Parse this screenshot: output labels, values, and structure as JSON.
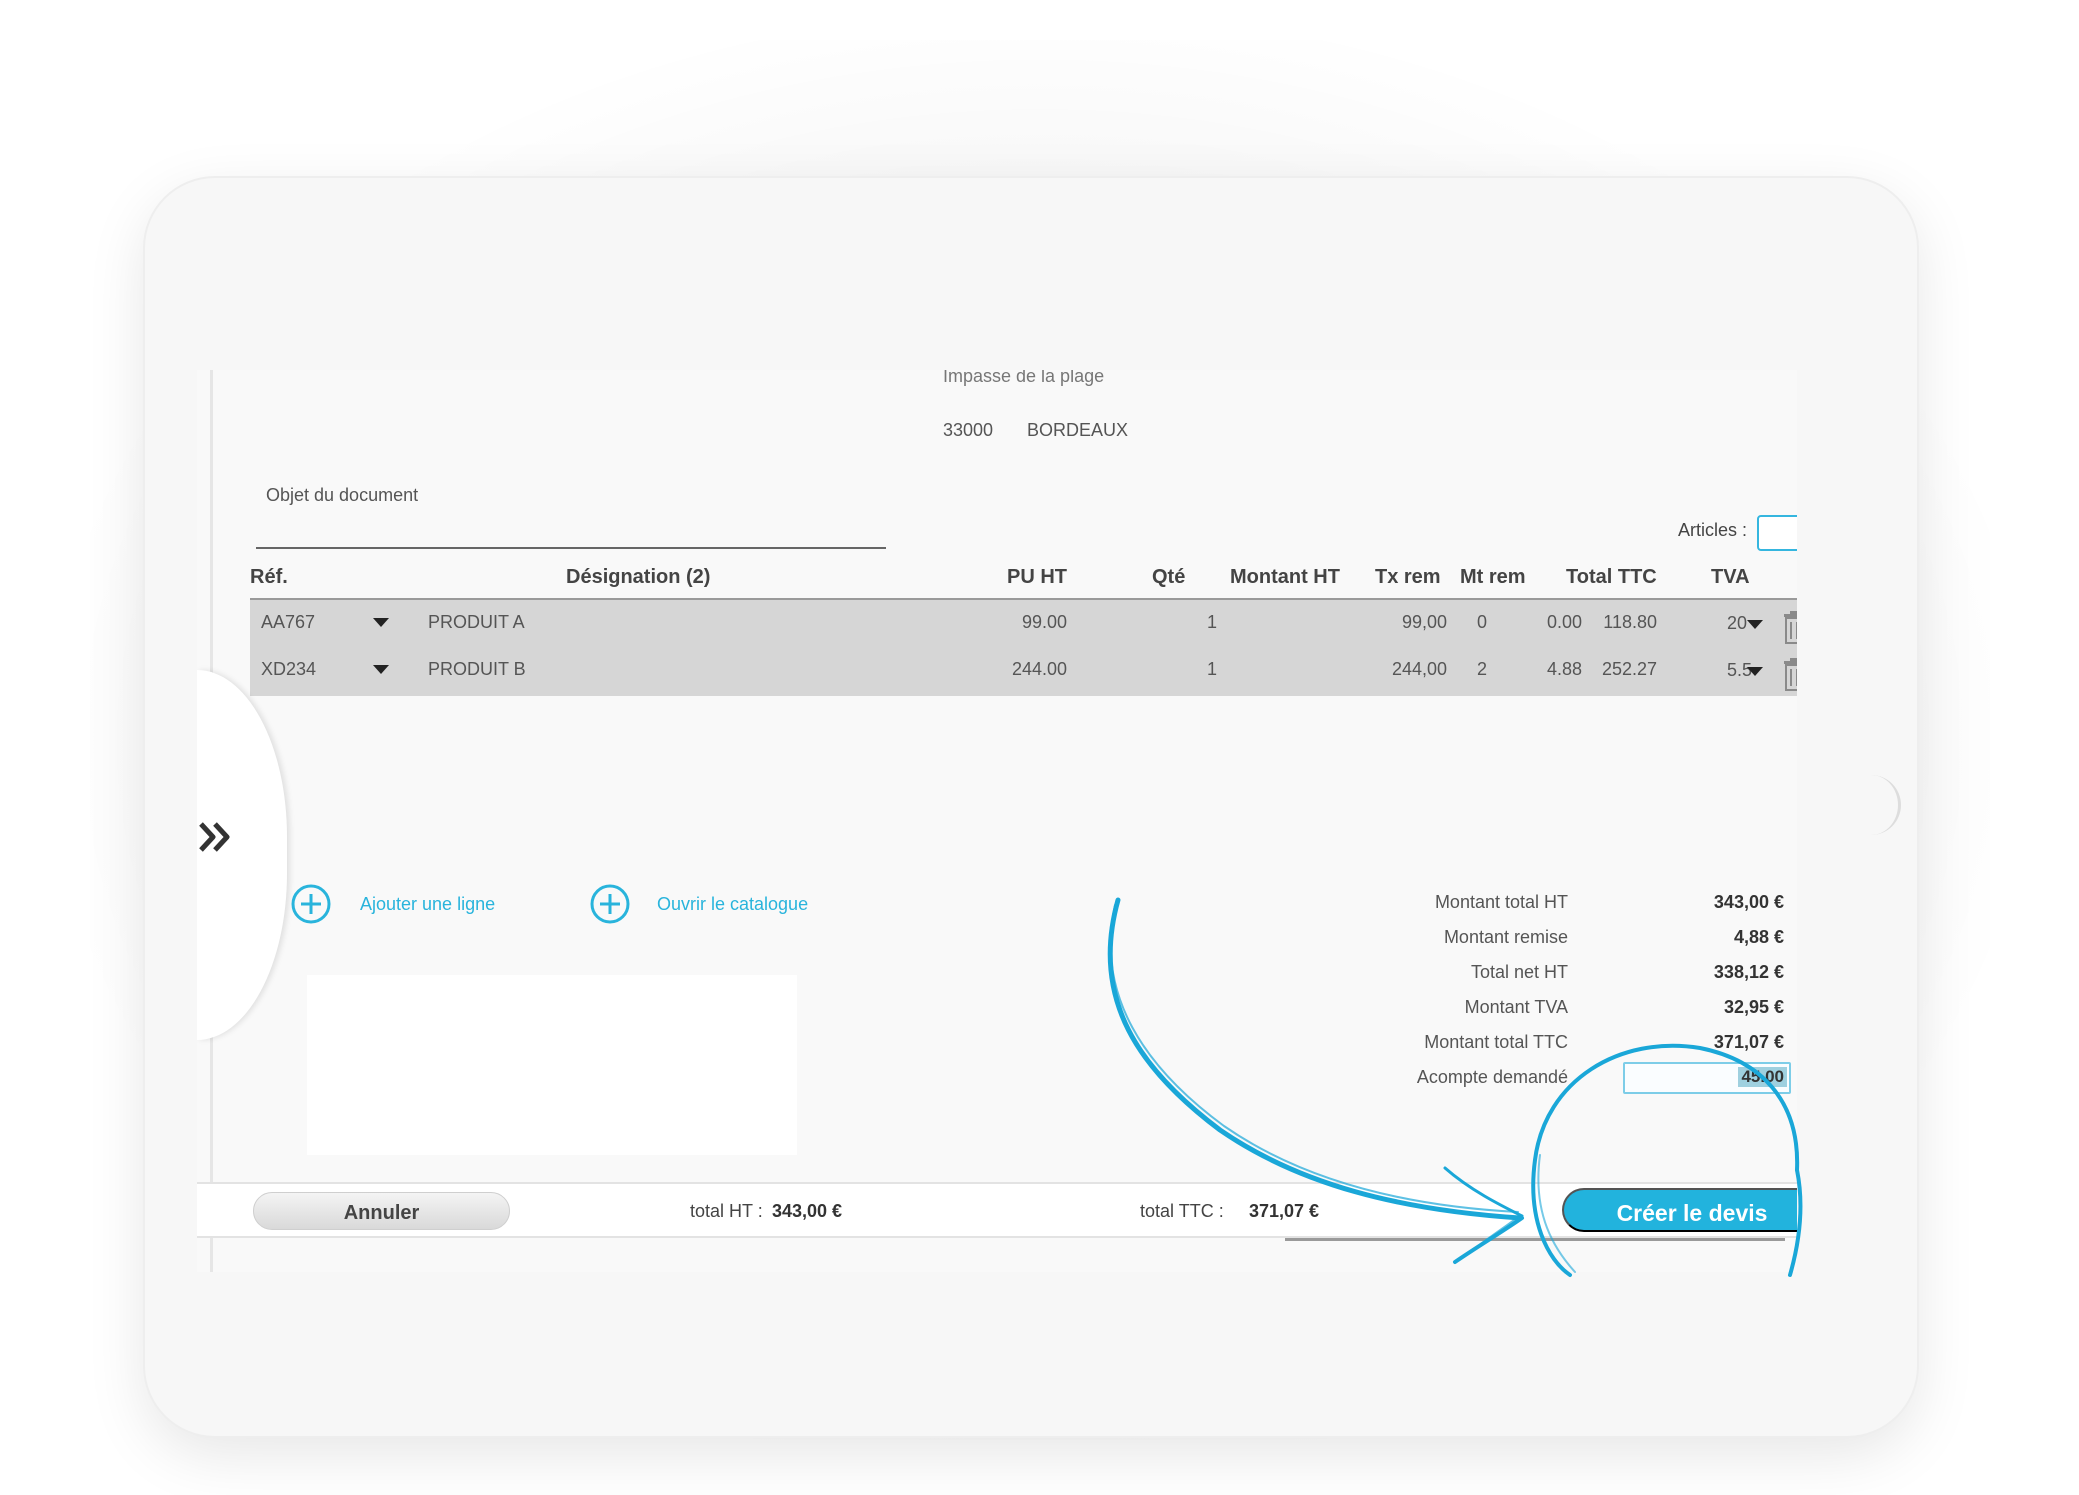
{
  "address": {
    "street": "Impasse de la plage",
    "postcode": "33000",
    "city": "BORDEAUX"
  },
  "object_label": "Objet du document",
  "articles_label": "Articles :",
  "table": {
    "headers": {
      "ref": "Réf.",
      "designation": "Désignation (2)",
      "pu_ht": "PU HT",
      "qte": "Qté",
      "montant_ht": "Montant HT",
      "tx_rem": "Tx rem",
      "mt_rem": "Mt rem",
      "total_ttc": "Total TTC",
      "tva": "TVA"
    },
    "rows": [
      {
        "ref": "AA767",
        "designation": "PRODUIT A",
        "pu_ht": "99.00",
        "qte": "1",
        "montant_ht": "99,00",
        "tx_rem": "0",
        "mt_rem": "0.00",
        "total_ttc": "118.80",
        "tva": "20"
      },
      {
        "ref": "XD234",
        "designation": "PRODUIT B",
        "pu_ht": "244.00",
        "qte": "1",
        "montant_ht": "244,00",
        "tx_rem": "2",
        "mt_rem": "4.88",
        "total_ttc": "252.27",
        "tva": "5.5"
      }
    ]
  },
  "actions": {
    "add_line": "Ajouter une ligne",
    "open_catalog": "Ouvrir le catalogue"
  },
  "summary": [
    {
      "label": "Montant total HT",
      "value": "343,00 €"
    },
    {
      "label": "Montant remise",
      "value": "4,88 €"
    },
    {
      "label": "Total net HT",
      "value": "338,12 €"
    },
    {
      "label": "Montant TVA",
      "value": "32,95 €"
    },
    {
      "label": "Montant total TTC",
      "value": "371,07 €"
    }
  ],
  "acompte": {
    "label": "Acompte demandé",
    "value": "45.00"
  },
  "footer": {
    "cancel": "Annuler",
    "total_ht_label": "total HT :",
    "total_ht_value": "343,00 €",
    "total_ttc_label": "total TTC :",
    "total_ttc_value": "371,07 €",
    "create": "Créer le devis"
  },
  "colors": {
    "accent": "#22b3dd",
    "annotation": "#1aa7d8"
  }
}
